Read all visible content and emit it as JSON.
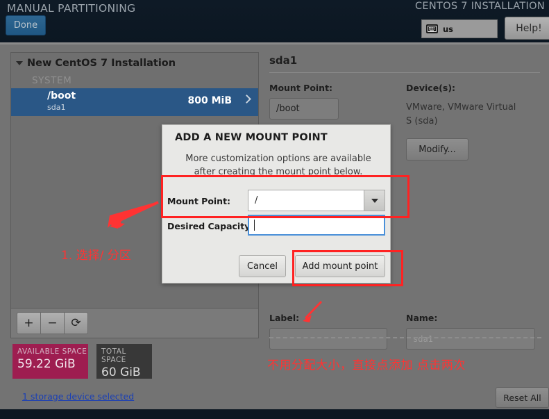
{
  "header": {
    "title": "MANUAL PARTITIONING",
    "product": "CENTOS 7 INSTALLATION",
    "done_label": "Done",
    "keyboard_layout": "us",
    "keyboard_icon": "keyboard-icon",
    "help_label": "Help!"
  },
  "left_panel": {
    "group_title": "New CentOS 7 Installation",
    "section_label": "SYSTEM",
    "partition": {
      "mount": "/boot",
      "device": "sda1",
      "size": "800 MiB"
    },
    "toolbar": {
      "add": "+",
      "remove": "−",
      "refresh": "⟳"
    }
  },
  "space": {
    "available_caption": "AVAILABLE SPACE",
    "available_value": "59.22 GiB",
    "total_caption": "TOTAL SPACE",
    "total_value": "60 GiB",
    "storage_link": "1 storage device selected",
    "available_color": "#9e1d50",
    "total_color": "#383838"
  },
  "details": {
    "title": "sda1",
    "mount_point_label": "Mount Point:",
    "mount_point_value": "/boot",
    "devices_label": "Device(s):",
    "devices_value": "VMware, VMware Virtual S (sda)",
    "modify_label": "Modify...",
    "label_label": "Label:",
    "label_value": "",
    "name_label": "Name:",
    "name_placeholder": "sda1",
    "reset_label": "Reset All"
  },
  "dialog": {
    "title": "ADD A NEW MOUNT POINT",
    "subtitle": "More customization options are available after creating the mount point below.",
    "mount_point_label": "Mount Point:",
    "mount_point_value": "/",
    "desired_capacity_label": "Desired Capacity:",
    "desired_capacity_value": "",
    "cancel_label": "Cancel",
    "add_label": "Add mount point"
  },
  "annotations": {
    "color": "#ff3333",
    "note_1": "1. 选择/ 分区",
    "note_2": "不用分配大小，直接点添加 点击两次"
  }
}
